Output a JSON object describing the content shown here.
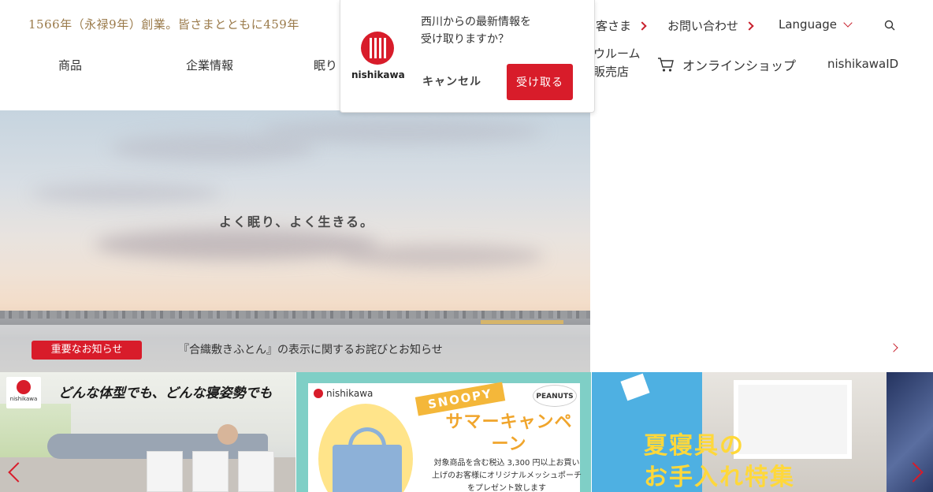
{
  "header": {
    "tagline": "1566年（永禄9年）創業。皆さまとともに459年",
    "util_links": [
      "客さま",
      "お問い合わせ",
      "Language"
    ],
    "nav": [
      "商品",
      "企業情報",
      "眠り"
    ],
    "nav_showroom": [
      "ウルーム",
      "販売店"
    ],
    "online_shop": "オンラインショップ",
    "nishikawa_id": "nishikawaID"
  },
  "hero": {
    "copy": "よく眠り、よく生きる。"
  },
  "notice": {
    "badge": "重要なお知らせ",
    "text": "『合織敷きふとん』の表示に関するお詫びとお知らせ"
  },
  "banners": {
    "b1_text": "どんな体型でも、どんな寝姿勢でも",
    "b1_logo": "nishikawa",
    "b2_logo": "nishikawa",
    "b2_tag": "SNOOPY",
    "b2_peanuts": "PEANUTS",
    "b2_title": "サマーキャンペーン",
    "b2_desc": "対象商品を含む税込 3,300 円以上お買い上げのお客様にオリジナルメッシュポーチをプレゼント致します",
    "b3_title_1": "夏寝具の",
    "b3_title_2": "お手入れ特集"
  },
  "popup": {
    "brand": "nishikawa",
    "message_1": "西川からの最新情報を",
    "message_2": "受け取りますか？",
    "cancel": "キャンセル",
    "accept": "受け取る"
  },
  "colors": {
    "brand_red": "#d81c2a",
    "tagline_gold": "#9a7a4a"
  }
}
